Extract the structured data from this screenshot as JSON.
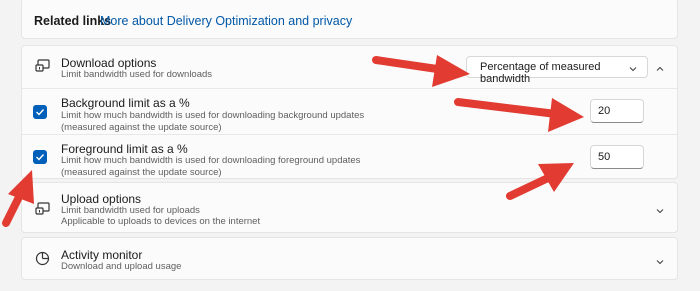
{
  "related_links": {
    "label": "Related links",
    "link": "More about Delivery Optimization and privacy"
  },
  "download_options": {
    "title": "Download options",
    "subtitle": "Limit bandwidth used for downloads",
    "dropdown_value": "Percentage of measured bandwidth",
    "expanded": true
  },
  "background_limit": {
    "title": "Background limit as a %",
    "line1": "Limit how much bandwidth is used for downloading background updates",
    "line2": "(measured against the update source)",
    "value": "20",
    "checked": true
  },
  "foreground_limit": {
    "title": "Foreground limit as a %",
    "line1": "Limit how much bandwidth is used for downloading foreground updates",
    "line2": "(measured against the update source)",
    "value": "50",
    "checked": true
  },
  "upload_options": {
    "title": "Upload options",
    "line1": "Limit bandwidth used for uploads",
    "line2": "Applicable to uploads to devices on the internet"
  },
  "activity_monitor": {
    "title": "Activity monitor",
    "subtitle": "Download and upload usage"
  },
  "colors": {
    "accent": "#005fb8",
    "link": "#0058a7",
    "annotation_arrow": "#e23b32"
  }
}
